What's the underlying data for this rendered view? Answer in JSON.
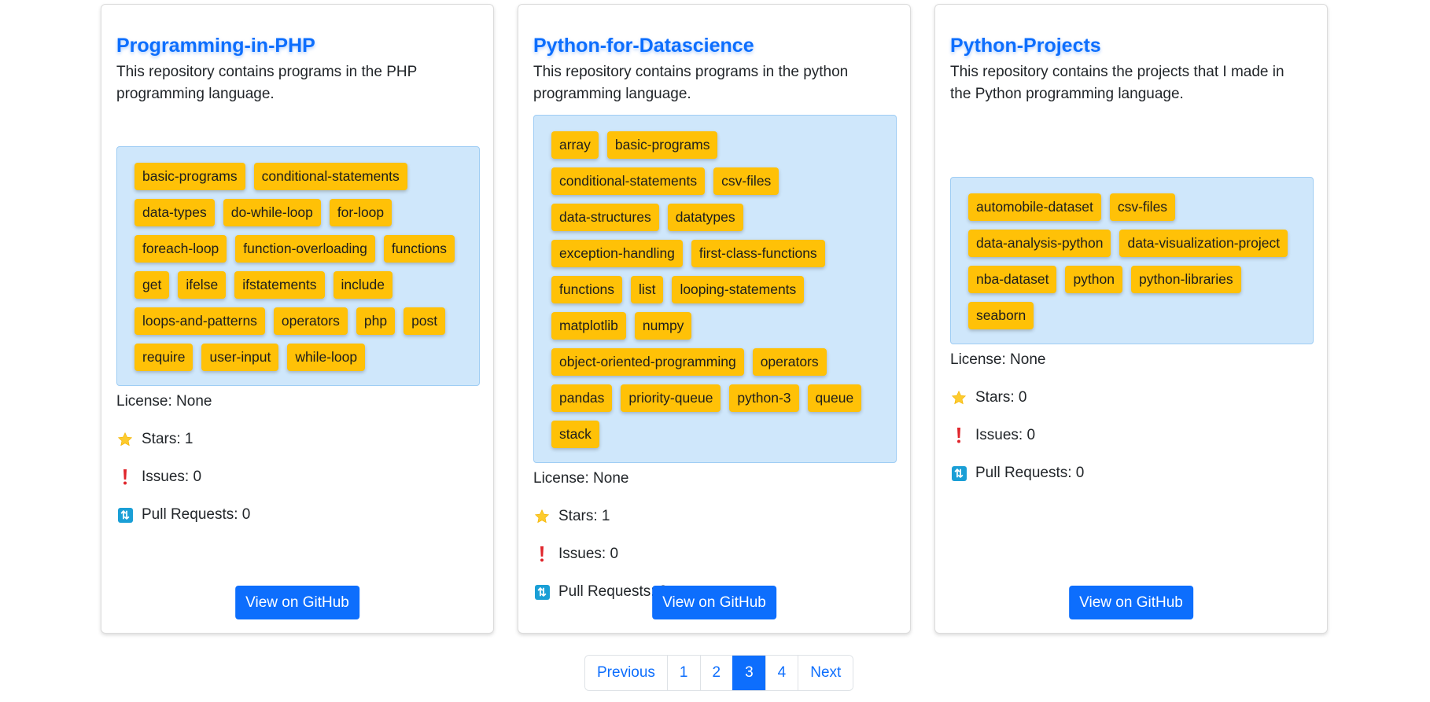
{
  "colors": {
    "accent": "#0d6efd",
    "tag": "#ffc107",
    "topics_bg": "#cfe7fb"
  },
  "cards": [
    {
      "title": "Programming-in-PHP",
      "description": "This repository contains programs in the PHP programming language.",
      "desc_lines": [
        "This repository contains programs in the PHP",
        "programming language."
      ],
      "topics": [
        "basic-programs",
        "conditional-statements",
        "data-types",
        "do-while-loop",
        "for-loop",
        "foreach-loop",
        "function-overloading",
        "functions",
        "get",
        "ifelse",
        "ifstatements",
        "include",
        "loops-and-patterns",
        "operators",
        "php",
        "post",
        "require",
        "user-input",
        "while-loop"
      ],
      "license": "License: None",
      "stars": "Stars: 1",
      "issues": "Issues: 0",
      "pull_requests": "Pull Requests: 0",
      "button_label": "View on GitHub"
    },
    {
      "title": "Python-for-Datascience",
      "description": "This repository contains programs in the python programming language.",
      "desc_lines": [
        "This repository contains programs in the python",
        "programming language."
      ],
      "topics": [
        "array",
        "basic-programs",
        "conditional-statements",
        "csv-files",
        "data-structures",
        "datatypes",
        "exception-handling",
        "first-class-functions",
        "functions",
        "list",
        "looping-statements",
        "matplotlib",
        "numpy",
        "object-oriented-programming",
        "operators",
        "pandas",
        "priority-queue",
        "python-3",
        "queue",
        "stack"
      ],
      "license": "License: None",
      "stars": "Stars: 1",
      "issues": "Issues: 0",
      "pull_requests": "Pull Requests: 0",
      "button_label": "View on GitHub"
    },
    {
      "title": "Python-Projects",
      "description": "This repository contains the projects that I made in the Python programming language.",
      "desc_lines": [
        "This repository contains the projects that I made in",
        "the Python programming language."
      ],
      "topics": [
        "automobile-dataset",
        "csv-files",
        "data-analysis-python",
        "data-visualization-project",
        "nba-dataset",
        "python",
        "python-libraries",
        "seaborn"
      ],
      "license": "License: None",
      "stars": "Stars: 0",
      "issues": "Issues: 0",
      "pull_requests": "Pull Requests: 0",
      "button_label": "View on GitHub"
    }
  ],
  "pagination": {
    "previous": "Previous",
    "pages": [
      "1",
      "2",
      "3",
      "4"
    ],
    "active": "3",
    "next": "Next"
  }
}
